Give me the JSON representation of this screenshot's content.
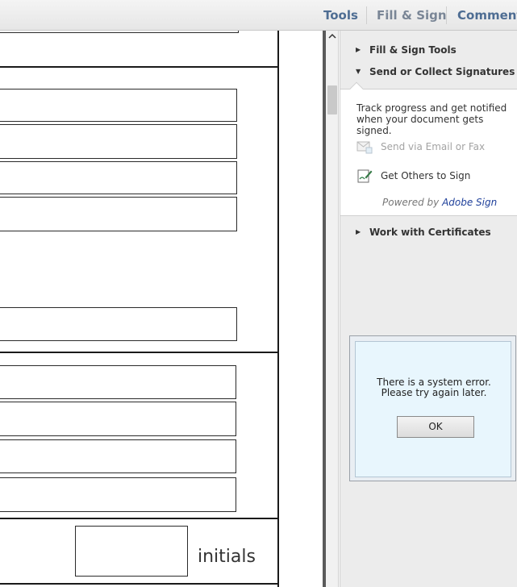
{
  "toolbar": {
    "tools_label": "Tools",
    "fill_sign_label": "Fill & Sign",
    "comment_label": "Comment"
  },
  "document": {
    "initials_label": "initials"
  },
  "pane": {
    "fill_sign_tools_label": "Fill & Sign Tools",
    "send_collect_label": "Send or Collect Signatures",
    "send_description": "Track progress and get notified when your document gets signed.",
    "send_email_fax_label": "Send via Email or Fax",
    "get_others_sign_label": "Get Others to Sign",
    "powered_by_prefix": "Powered by",
    "powered_by_brand": "Adobe Sign",
    "work_with_certificates_label": "Work with Certificates"
  },
  "dialog": {
    "message": "There is a system error. Please try again later.",
    "ok_label": "OK"
  },
  "icons": {
    "collapsed": "triangle-right-icon",
    "expanded": "triangle-down-icon",
    "scroll_up": "chevron-up-icon",
    "email": "envelope-icon",
    "sign": "pen-sign-icon"
  },
  "colors": {
    "toolbar_text": "#4e6d93",
    "brand_link": "#1e3f9a",
    "dialog_bg": "#e8f6fd",
    "pane_bg": "#ececec"
  }
}
